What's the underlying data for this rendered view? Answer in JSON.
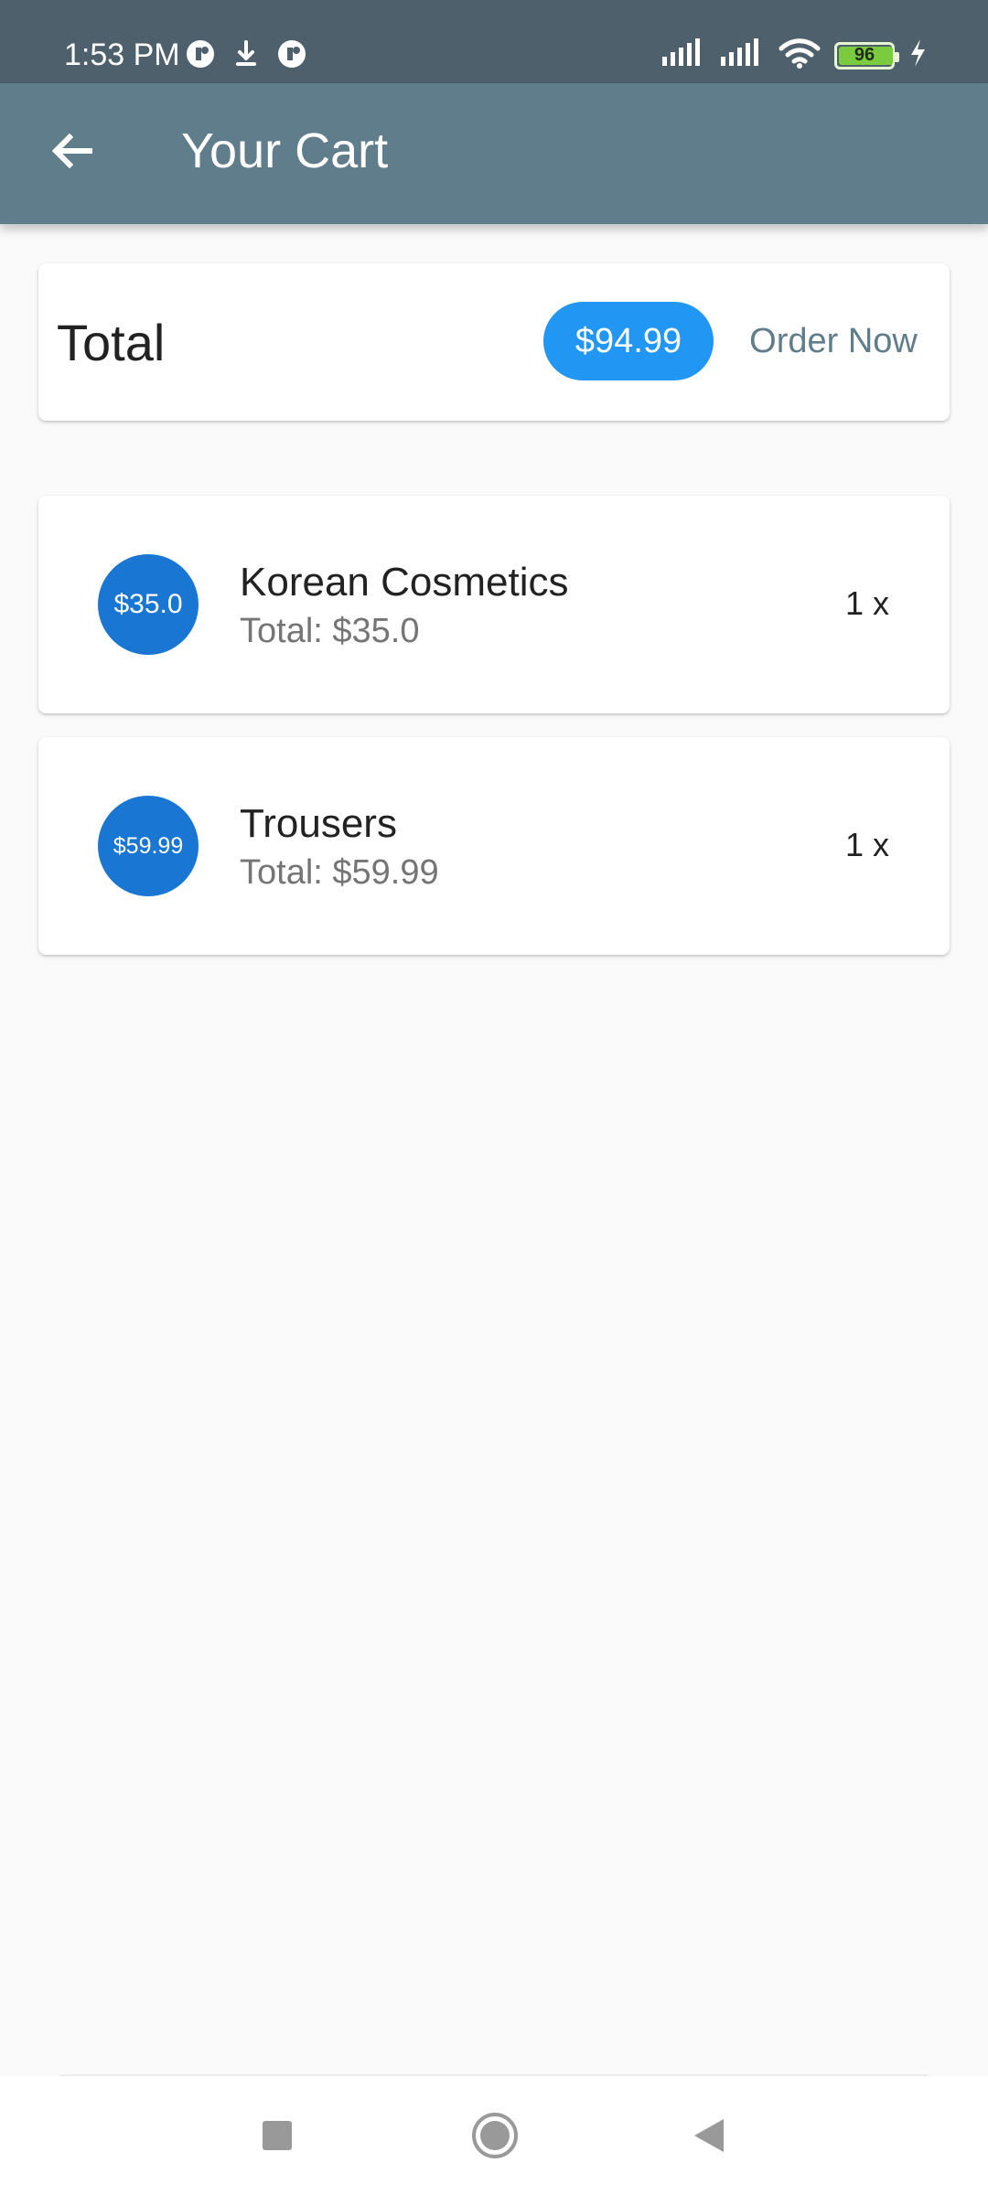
{
  "status_bar": {
    "time": "1:53 PM",
    "battery": "96",
    "battery_level_percent": 96,
    "icons": [
      "notification-icon",
      "download-icon",
      "notification-icon",
      "signal-icon",
      "signal-icon",
      "wifi-icon",
      "battery-icon",
      "charging-icon"
    ]
  },
  "app_bar": {
    "title": "Your Cart",
    "back_icon": "arrow-left-icon"
  },
  "summary": {
    "label": "Total",
    "total": "$94.99",
    "order_label": "Order Now"
  },
  "items": [
    {
      "avatar": "$35.0",
      "name": "Korean Cosmetics",
      "total": "Total: $35.0",
      "quantity": "1 x"
    },
    {
      "avatar": "$59.99",
      "name": "Trousers",
      "total": "Total: $59.99",
      "quantity": "1 x"
    }
  ],
  "colors": {
    "status_bar": "#4d606b",
    "app_bar": "#607d8b",
    "chip": "#2196f3",
    "avatar": "#1976d2",
    "order_text": "#607d8b",
    "background": "#fafafa"
  },
  "system_nav": {
    "icons": [
      "recents-icon",
      "home-icon",
      "back-icon"
    ]
  }
}
